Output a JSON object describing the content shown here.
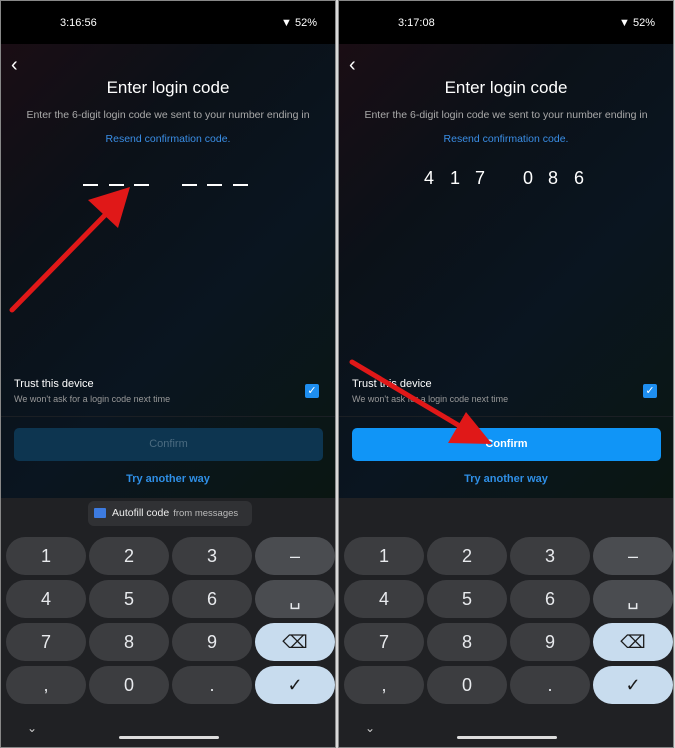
{
  "screens": [
    {
      "status": {
        "time": "3:16:56",
        "battery": "52%"
      },
      "back_icon": "chevron-left",
      "title": "Enter login code",
      "subtitle": "Enter the 6-digit login code we sent to your number ending in",
      "resend": "Resend confirmation code.",
      "code": [
        "",
        "",
        "",
        "",
        "",
        ""
      ],
      "trust": {
        "label": "Trust this device",
        "sub": "We won't ask for a login code next time",
        "checked": true
      },
      "confirm": {
        "label": "Confirm",
        "enabled": false
      },
      "another": "Try another way",
      "autofill": {
        "label": "Autofill code",
        "sub": "from messages"
      }
    },
    {
      "status": {
        "time": "3:17:08",
        "battery": "52%"
      },
      "back_icon": "chevron-left",
      "title": "Enter login code",
      "subtitle": "Enter the 6-digit login code we sent to your number ending in",
      "resend": "Resend confirmation code.",
      "code": [
        "4",
        "1",
        "7",
        "0",
        "8",
        "6"
      ],
      "trust": {
        "label": "Trust this device",
        "sub": "We won't ask for a login code next time",
        "checked": true
      },
      "confirm": {
        "label": "Confirm",
        "enabled": true
      },
      "another": "Try another way"
    }
  ],
  "keypad": [
    "1",
    "2",
    "3",
    "–",
    "4",
    "5",
    "6",
    "␣",
    "7",
    "8",
    "9",
    "⌫",
    ",",
    "0",
    ".",
    "✓"
  ],
  "colors": {
    "accent": "#1095f7",
    "annotation": "#e01818"
  }
}
